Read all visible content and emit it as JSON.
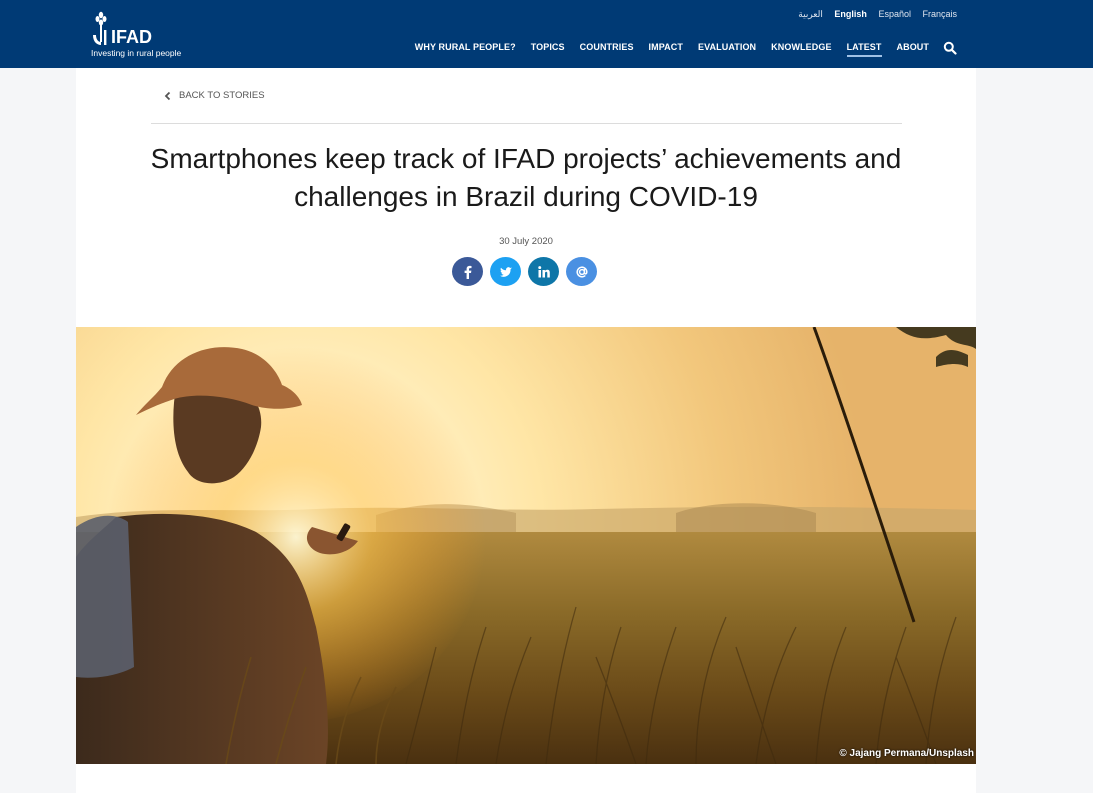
{
  "brand": {
    "name": "IFAD",
    "tagline": "Investing in rural people"
  },
  "languages": [
    {
      "label": "العربية",
      "active": false
    },
    {
      "label": "English",
      "active": true
    },
    {
      "label": "Español",
      "active": false
    },
    {
      "label": "Français",
      "active": false
    }
  ],
  "nav": [
    {
      "label": "WHY RURAL PEOPLE?"
    },
    {
      "label": "TOPICS"
    },
    {
      "label": "COUNTRIES"
    },
    {
      "label": "IMPACT"
    },
    {
      "label": "EVALUATION"
    },
    {
      "label": "KNOWLEDGE"
    },
    {
      "label": "LATEST",
      "active": true
    },
    {
      "label": "ABOUT"
    }
  ],
  "article": {
    "back_label": "BACK TO STORIES",
    "title_line1": "Smartphones keep track of IFAD projects’ achievements and",
    "title_line2": "challenges in Brazil during COVID-19",
    "date": "30 July 2020",
    "image_credit": "© Jajang Permana/Unsplash"
  },
  "share": [
    {
      "name": "facebook",
      "icon": "facebook-icon",
      "color": "#3b5998"
    },
    {
      "name": "twitter",
      "icon": "twitter-icon",
      "color": "#1da1f2"
    },
    {
      "name": "linkedin",
      "icon": "linkedin-icon",
      "color": "#0e76a8"
    },
    {
      "name": "email",
      "icon": "at-icon",
      "color": "#4a90e2"
    }
  ],
  "colors": {
    "header_bg": "#003a75",
    "page_bg": "#f5f6f8"
  }
}
